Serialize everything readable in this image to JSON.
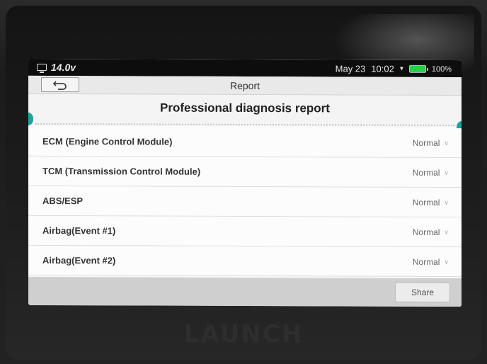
{
  "status_bar": {
    "voltage": "14.0v",
    "date": "May 23",
    "time": "10:02",
    "battery": "100%",
    "battery_color": "#2ecc40"
  },
  "header": {
    "back_icon": "back-arrow-icon",
    "title": "Report"
  },
  "report": {
    "title": "Professional diagnosis report",
    "accent_color": "#1aa39a"
  },
  "modules": [
    {
      "name": "ECM (Engine Control Module)",
      "status": "Normal"
    },
    {
      "name": "TCM (Transmission Control Module)",
      "status": "Normal"
    },
    {
      "name": "ABS/ESP",
      "status": "Normal"
    },
    {
      "name": "Airbag(Event #1)",
      "status": "Normal"
    },
    {
      "name": "Airbag(Event #2)",
      "status": "Normal"
    }
  ],
  "footer": {
    "share_label": "Share"
  },
  "device": {
    "brand": "LAUNCH"
  }
}
